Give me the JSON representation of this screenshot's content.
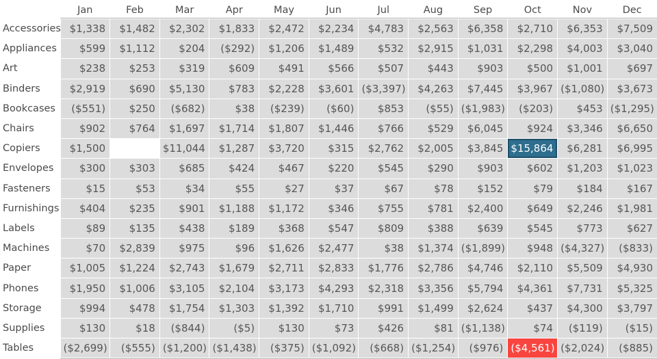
{
  "view": {
    "type": "crosstab",
    "corner_label": "",
    "background": "#ffffff",
    "cell_background": "#dcdcdc",
    "text_color": "#4a4a4a",
    "highlight_blue": "#2e6e8e",
    "highlight_red": "#f8453f",
    "highlight_text": "#ffffff"
  },
  "chart_data": {
    "type": "table",
    "title": "",
    "xlabel": "",
    "ylabel": "",
    "grid": true,
    "legend": "none",
    "value_format": "currency-usd-parenthesized-negatives",
    "categories": [
      "Jan",
      "Feb",
      "Mar",
      "Apr",
      "May",
      "Jun",
      "Jul",
      "Aug",
      "Sep",
      "Oct",
      "Nov",
      "Dec"
    ],
    "row_labels": [
      "Accessories",
      "Appliances",
      "Art",
      "Binders",
      "Bookcases",
      "Chairs",
      "Copiers",
      "Envelopes",
      "Fasteners",
      "Furnishings",
      "Labels",
      "Machines",
      "Paper",
      "Phones",
      "Storage",
      "Supplies",
      "Tables"
    ],
    "series": [
      {
        "name": "Accessories",
        "values": [
          1338,
          1482,
          2302,
          1833,
          2472,
          2234,
          4783,
          2563,
          6358,
          2710,
          6353,
          7509
        ]
      },
      {
        "name": "Appliances",
        "values": [
          599,
          1112,
          204,
          -292,
          1206,
          1489,
          532,
          2915,
          1031,
          2298,
          4003,
          3040
        ]
      },
      {
        "name": "Art",
        "values": [
          238,
          253,
          319,
          609,
          491,
          566,
          507,
          443,
          903,
          500,
          1001,
          697
        ]
      },
      {
        "name": "Binders",
        "values": [
          2919,
          690,
          5130,
          783,
          2228,
          3601,
          -3397,
          4263,
          7445,
          3967,
          -1080,
          3673
        ]
      },
      {
        "name": "Bookcases",
        "values": [
          -551,
          250,
          -682,
          38,
          -239,
          -60,
          853,
          -55,
          -1983,
          -203,
          453,
          -1295
        ]
      },
      {
        "name": "Chairs",
        "values": [
          902,
          764,
          1697,
          1714,
          1807,
          1446,
          766,
          529,
          6045,
          924,
          3346,
          6650
        ]
      },
      {
        "name": "Copiers",
        "values": [
          1500,
          null,
          11044,
          1287,
          3720,
          315,
          2762,
          2005,
          3845,
          15864,
          6281,
          6995
        ]
      },
      {
        "name": "Envelopes",
        "values": [
          300,
          303,
          685,
          424,
          467,
          220,
          545,
          290,
          903,
          602,
          1203,
          1023
        ]
      },
      {
        "name": "Fasteners",
        "values": [
          15,
          53,
          34,
          55,
          27,
          37,
          67,
          78,
          152,
          79,
          184,
          167
        ]
      },
      {
        "name": "Furnishings",
        "values": [
          404,
          235,
          901,
          1188,
          1172,
          346,
          755,
          781,
          2400,
          649,
          2246,
          1981
        ]
      },
      {
        "name": "Labels",
        "values": [
          89,
          135,
          438,
          189,
          368,
          547,
          809,
          388,
          639,
          545,
          773,
          627
        ]
      },
      {
        "name": "Machines",
        "values": [
          70,
          2839,
          975,
          96,
          1626,
          2477,
          38,
          1374,
          -1899,
          948,
          -4327,
          -833
        ]
      },
      {
        "name": "Paper",
        "values": [
          1005,
          1224,
          2743,
          1679,
          2711,
          2833,
          1776,
          2786,
          4746,
          2110,
          5509,
          4930
        ]
      },
      {
        "name": "Phones",
        "values": [
          1950,
          1006,
          3105,
          2104,
          3173,
          4293,
          2318,
          3356,
          5794,
          4361,
          7731,
          5325
        ]
      },
      {
        "name": "Storage",
        "values": [
          994,
          478,
          1754,
          1303,
          1392,
          1710,
          991,
          1499,
          2624,
          437,
          4300,
          3797
        ]
      },
      {
        "name": "Supplies",
        "values": [
          130,
          18,
          -844,
          -5,
          130,
          73,
          426,
          81,
          -1138,
          74,
          -119,
          -15
        ]
      },
      {
        "name": "Tables",
        "values": [
          -2699,
          -555,
          -1200,
          -1438,
          -375,
          -1092,
          -668,
          -1254,
          -976,
          -4561,
          -2024,
          -885
        ]
      }
    ]
  },
  "columns": [
    "Jan",
    "Feb",
    "Mar",
    "Apr",
    "May",
    "Jun",
    "Jul",
    "Aug",
    "Sep",
    "Oct",
    "Nov",
    "Dec"
  ],
  "rows": [
    {
      "label": "Accessories",
      "cells": [
        "$1,338",
        "$1,482",
        "$2,302",
        "$1,833",
        "$2,472",
        "$2,234",
        "$4,783",
        "$2,563",
        "$6,358",
        "$2,710",
        "$6,353",
        "$7,509"
      ]
    },
    {
      "label": "Appliances",
      "cells": [
        "$599",
        "$1,112",
        "$204",
        "($292)",
        "$1,206",
        "$1,489",
        "$532",
        "$2,915",
        "$1,031",
        "$2,298",
        "$4,003",
        "$3,040"
      ]
    },
    {
      "label": "Art",
      "cells": [
        "$238",
        "$253",
        "$319",
        "$609",
        "$491",
        "$566",
        "$507",
        "$443",
        "$903",
        "$500",
        "$1,001",
        "$697"
      ]
    },
    {
      "label": "Binders",
      "cells": [
        "$2,919",
        "$690",
        "$5,130",
        "$783",
        "$2,228",
        "$3,601",
        "($3,397)",
        "$4,263",
        "$7,445",
        "$3,967",
        "($1,080)",
        "$3,673"
      ]
    },
    {
      "label": "Bookcases",
      "cells": [
        "($551)",
        "$250",
        "($682)",
        "$38",
        "($239)",
        "($60)",
        "$853",
        "($55)",
        "($1,983)",
        "($203)",
        "$453",
        "($1,295)"
      ]
    },
    {
      "label": "Chairs",
      "cells": [
        "$902",
        "$764",
        "$1,697",
        "$1,714",
        "$1,807",
        "$1,446",
        "$766",
        "$529",
        "$6,045",
        "$924",
        "$3,346",
        "$6,650"
      ]
    },
    {
      "label": "Copiers",
      "cells": [
        "$1,500",
        "",
        "$11,044",
        "$1,287",
        "$3,720",
        "$315",
        "$2,762",
        "$2,005",
        "$3,845",
        "$15,864",
        "$6,281",
        "$6,995"
      ]
    },
    {
      "label": "Envelopes",
      "cells": [
        "$300",
        "$303",
        "$685",
        "$424",
        "$467",
        "$220",
        "$545",
        "$290",
        "$903",
        "$602",
        "$1,203",
        "$1,023"
      ]
    },
    {
      "label": "Fasteners",
      "cells": [
        "$15",
        "$53",
        "$34",
        "$55",
        "$27",
        "$37",
        "$67",
        "$78",
        "$152",
        "$79",
        "$184",
        "$167"
      ]
    },
    {
      "label": "Furnishings",
      "cells": [
        "$404",
        "$235",
        "$901",
        "$1,188",
        "$1,172",
        "$346",
        "$755",
        "$781",
        "$2,400",
        "$649",
        "$2,246",
        "$1,981"
      ]
    },
    {
      "label": "Labels",
      "cells": [
        "$89",
        "$135",
        "$438",
        "$189",
        "$368",
        "$547",
        "$809",
        "$388",
        "$639",
        "$545",
        "$773",
        "$627"
      ]
    },
    {
      "label": "Machines",
      "cells": [
        "$70",
        "$2,839",
        "$975",
        "$96",
        "$1,626",
        "$2,477",
        "$38",
        "$1,374",
        "($1,899)",
        "$948",
        "($4,327)",
        "($833)"
      ]
    },
    {
      "label": "Paper",
      "cells": [
        "$1,005",
        "$1,224",
        "$2,743",
        "$1,679",
        "$2,711",
        "$2,833",
        "$1,776",
        "$2,786",
        "$4,746",
        "$2,110",
        "$5,509",
        "$4,930"
      ]
    },
    {
      "label": "Phones",
      "cells": [
        "$1,950",
        "$1,006",
        "$3,105",
        "$2,104",
        "$3,173",
        "$4,293",
        "$2,318",
        "$3,356",
        "$5,794",
        "$4,361",
        "$7,731",
        "$5,325"
      ]
    },
    {
      "label": "Storage",
      "cells": [
        "$994",
        "$478",
        "$1,754",
        "$1,303",
        "$1,392",
        "$1,710",
        "$991",
        "$1,499",
        "$2,624",
        "$437",
        "$4,300",
        "$3,797"
      ]
    },
    {
      "label": "Supplies",
      "cells": [
        "$130",
        "$18",
        "($844)",
        "($5)",
        "$130",
        "$73",
        "$426",
        "$81",
        "($1,138)",
        "$74",
        "($119)",
        "($15)"
      ]
    },
    {
      "label": "Tables",
      "cells": [
        "($2,699)",
        "($555)",
        "($1,200)",
        "($1,438)",
        "($375)",
        "($1,092)",
        "($668)",
        "($1,254)",
        "($976)",
        "($4,561)",
        "($2,024)",
        "($885)"
      ]
    }
  ],
  "highlights": [
    {
      "row": "Copiers",
      "column": "Oct",
      "value": "$15,864",
      "style": "blue"
    },
    {
      "row": "Tables",
      "column": "Oct",
      "value": "($4,561)",
      "style": "red"
    }
  ]
}
